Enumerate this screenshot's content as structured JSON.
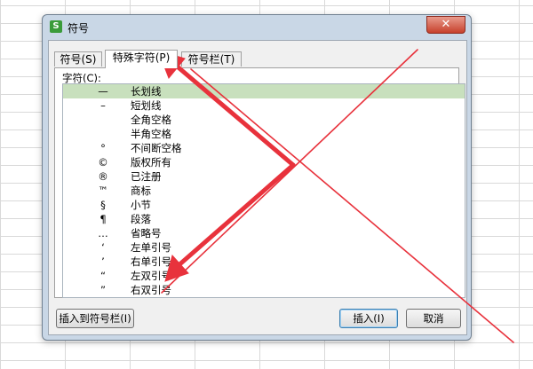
{
  "dialog": {
    "title": "符号",
    "app_icon_letter": "S",
    "close_symbol": "✕"
  },
  "tabs": [
    {
      "label": "符号(S)",
      "active": false
    },
    {
      "label": "特殊字符(P)",
      "active": true
    },
    {
      "label": "符号栏(T)",
      "active": false
    }
  ],
  "char_label": "字符(C):",
  "rows": [
    {
      "symbol": "—",
      "name": "长划线",
      "selected": true
    },
    {
      "symbol": "–",
      "name": "短划线",
      "selected": false
    },
    {
      "symbol": "",
      "name": "全角空格",
      "selected": false
    },
    {
      "symbol": "",
      "name": "半角空格",
      "selected": false
    },
    {
      "symbol": "°",
      "name": "不间断空格",
      "selected": false
    },
    {
      "symbol": "©",
      "name": "版权所有",
      "selected": false
    },
    {
      "symbol": "®",
      "name": "已注册",
      "selected": false
    },
    {
      "symbol": "™",
      "name": "商标",
      "selected": false
    },
    {
      "symbol": "§",
      "name": "小节",
      "selected": false
    },
    {
      "symbol": "¶",
      "name": "段落",
      "selected": false
    },
    {
      "symbol": "…",
      "name": "省略号",
      "selected": false
    },
    {
      "symbol": "‘",
      "name": "左单引号",
      "selected": false
    },
    {
      "symbol": "’",
      "name": "右单引号",
      "selected": false
    },
    {
      "symbol": "“",
      "name": "左双引号",
      "selected": false
    },
    {
      "symbol": "”",
      "name": "右双引号",
      "selected": false
    }
  ],
  "buttons": {
    "insert_to_bar": "插入到符号栏(I)",
    "insert": "插入(I)",
    "cancel": "取消"
  },
  "colors": {
    "annotation_red": "#e8323c",
    "selected_row": "#c8e0bd",
    "dialog_frame": "#c9d7e6"
  }
}
